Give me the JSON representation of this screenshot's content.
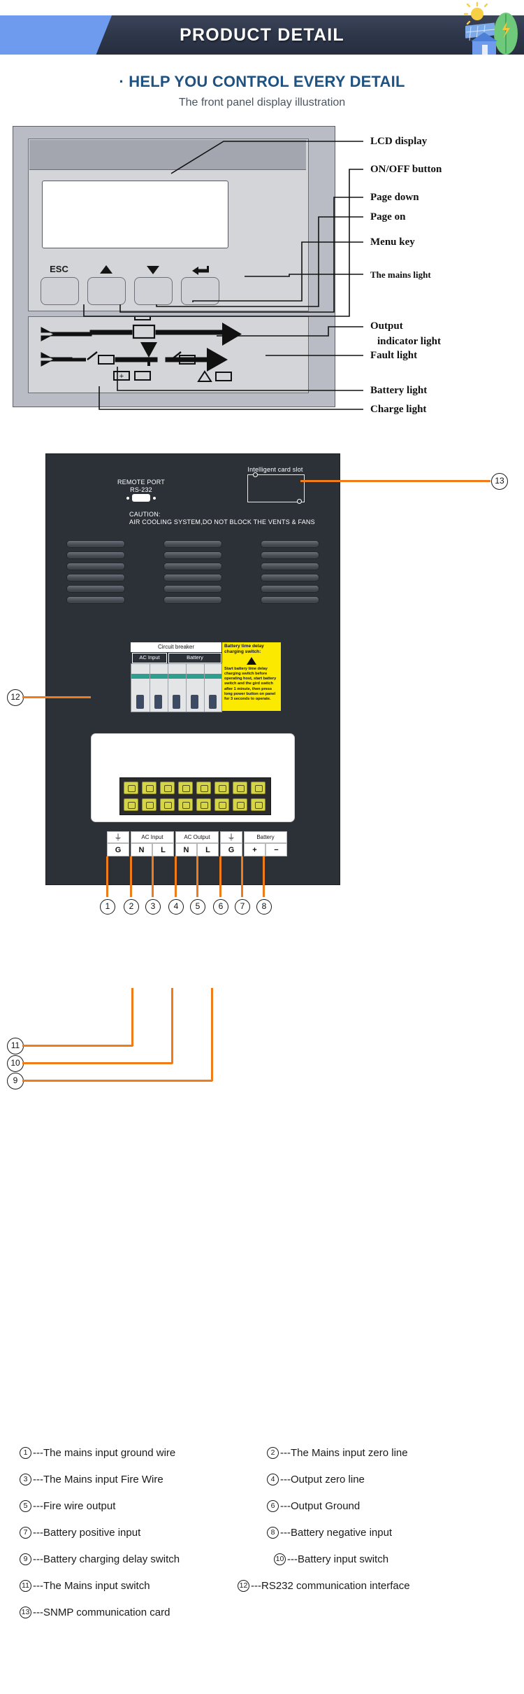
{
  "banner": {
    "title": "PRODUCT DETAIL",
    "logo_icon": "solar-house-icon"
  },
  "section": {
    "heading": "· HELP YOU CONTROL EVERY DETAIL",
    "subheading": "The front panel display illustration"
  },
  "front_panel": {
    "keys": [
      {
        "label": "ESC",
        "icon": "esc-key"
      },
      {
        "label": "",
        "icon": "arrow-up-icon"
      },
      {
        "label": "",
        "icon": "arrow-down-icon"
      },
      {
        "label": "",
        "icon": "enter-arrow-icon"
      }
    ],
    "callouts": [
      {
        "label": "LCD display"
      },
      {
        "label": "ON/OFF button"
      },
      {
        "label": "Page down"
      },
      {
        "label": "Page on"
      },
      {
        "label": "Menu key"
      },
      {
        "label": "The mains light"
      },
      {
        "label": "Output"
      },
      {
        "label": "indicator light"
      },
      {
        "label": "Fault light"
      },
      {
        "label": "Battery light"
      },
      {
        "label": "Charge light"
      }
    ]
  },
  "rear_panel": {
    "remote_port_line1": "REMOTE PORT",
    "remote_port_line2": "RS-232",
    "card_slot": "Intelligent card slot",
    "caution_line1": "CAUTION:",
    "caution_line2": "AIR COOLING SYSTEM,DO NOT BLOCK THE VENTS & FANS",
    "breaker_header": "Circuit breaker",
    "breaker_ac": "AC Input",
    "breaker_battery": "Battery",
    "yellow_title": "Battery time delay charging switch:",
    "yellow_body": "Start battery time delay charging switch before operating host, start battery switch and the gird switch after 1 minute, then press long power button on panel for 3 seconds to operate.",
    "warning_icon": "warning-triangle-icon",
    "terminal_groups": [
      {
        "top": "⊕",
        "top_icon": "ground-icon",
        "cells": [
          "G"
        ]
      },
      {
        "top": "AC Input",
        "cells": [
          "N",
          "L"
        ]
      },
      {
        "top": "AC Output",
        "cells": [
          "N",
          "L"
        ]
      },
      {
        "top": "⊕",
        "top_icon": "ground-icon",
        "cells": [
          "G"
        ]
      },
      {
        "top": "Battery",
        "cells": [
          "+",
          "−"
        ]
      }
    ],
    "bottom_numbers": [
      "1",
      "2",
      "3",
      "4",
      "5",
      "6",
      "7",
      "8"
    ],
    "left_numbers": [
      "11",
      "10",
      "9"
    ],
    "right_number": "13",
    "far_left_number": "12"
  },
  "legend": {
    "rows": [
      [
        {
          "num": "1",
          "dash": "--- ",
          "text": "The mains input ground wire"
        },
        {
          "num": "2",
          "dash": "---",
          "text": "The Mains input zero line"
        }
      ],
      [
        {
          "num": "3",
          "dash": "---",
          "text": "The Mains input Fire Wire"
        },
        {
          "num": "4",
          "dash": "--- ",
          "text": "Output zero line"
        }
      ],
      [
        {
          "num": "5",
          "dash": " ---",
          "text": "Fire wire output"
        },
        {
          "num": "6",
          "dash": "--- ",
          "text": "Output Ground"
        }
      ],
      [
        {
          "num": "7",
          "dash": " --- ",
          "text": "Battery positive input"
        },
        {
          "num": "8",
          "dash": "--- ",
          "text": "Battery negative input"
        }
      ],
      [
        {
          "num": "9",
          "dash": " --- ",
          "text": "Battery charging delay switch"
        },
        {
          "num": "10",
          "dash": "---",
          "text": "Battery input switch"
        }
      ],
      [
        {
          "num": "11",
          "dash": "--- ",
          "text": "The Mains input switch"
        },
        {
          "num": "12",
          "dash": "--- ",
          "text": "RS232 communication interface"
        }
      ],
      [
        {
          "num": "13",
          "dash": "---",
          "text": "SNMP communication card"
        }
      ]
    ]
  },
  "colors": {
    "banner_dark": "#2e374a",
    "banner_tab_blue": "#6f9bef",
    "heading_blue": "#1d5283",
    "panel_dark": "#2c3138",
    "accent_orange": "#ef7c18",
    "warning_yellow": "#fbe900",
    "breaker_green": "#2e9e8f"
  }
}
